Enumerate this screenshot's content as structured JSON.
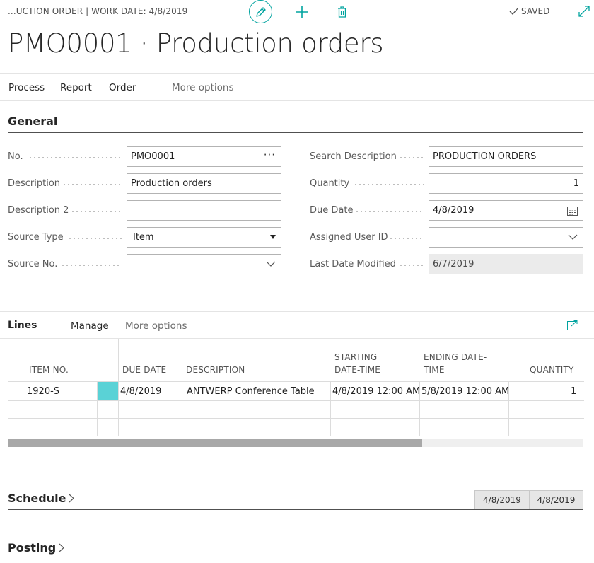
{
  "header": {
    "breadcrumb": "...UCTION ORDER | WORK DATE: 4/8/2019",
    "saved_label": "SAVED",
    "title": "PMO0001 · Production orders"
  },
  "actions": {
    "process": "Process",
    "report": "Report",
    "order": "Order",
    "more_options": "More options"
  },
  "general": {
    "title": "General",
    "left": [
      {
        "label": "No.",
        "value": "PMO0001"
      },
      {
        "label": "Description",
        "value": "Production orders"
      },
      {
        "label": "Description 2",
        "value": ""
      },
      {
        "label": "Source Type",
        "value": "Item"
      },
      {
        "label": "Source No.",
        "value": ""
      }
    ],
    "right": [
      {
        "label": "Search Description",
        "value": "PRODUCTION ORDERS"
      },
      {
        "label": "Quantity",
        "value": "1"
      },
      {
        "label": "Due Date",
        "value": "4/8/2019"
      },
      {
        "label": "Assigned User ID",
        "value": ""
      },
      {
        "label": "Last Date Modified",
        "value": "6/7/2019"
      }
    ]
  },
  "lines": {
    "title": "Lines",
    "manage": "Manage",
    "more_options": "More options",
    "columns": {
      "item_no": "ITEM NO.",
      "due_date": "DUE DATE",
      "description": "DESCRIPTION",
      "starting_1": "STARTING",
      "starting_2": "DATE-TIME",
      "ending_1": "ENDING DATE-",
      "ending_2": "TIME",
      "quantity": "QUANTITY"
    },
    "rows": [
      {
        "item_no": "1920-S",
        "due_date": "4/8/2019",
        "description": "ANTWERP Conference Table",
        "starting": "4/8/2019 12:00 AM",
        "ending": "5/8/2019 12:00 AM",
        "quantity": "1"
      }
    ],
    "scroll_position": 0.72
  },
  "schedule": {
    "title": "Schedule",
    "date1": "4/8/2019",
    "date2": "4/8/2019"
  },
  "posting": {
    "title": "Posting"
  },
  "colors": {
    "accent": "#00a39f",
    "selected_cell": "#5ad2d6"
  }
}
